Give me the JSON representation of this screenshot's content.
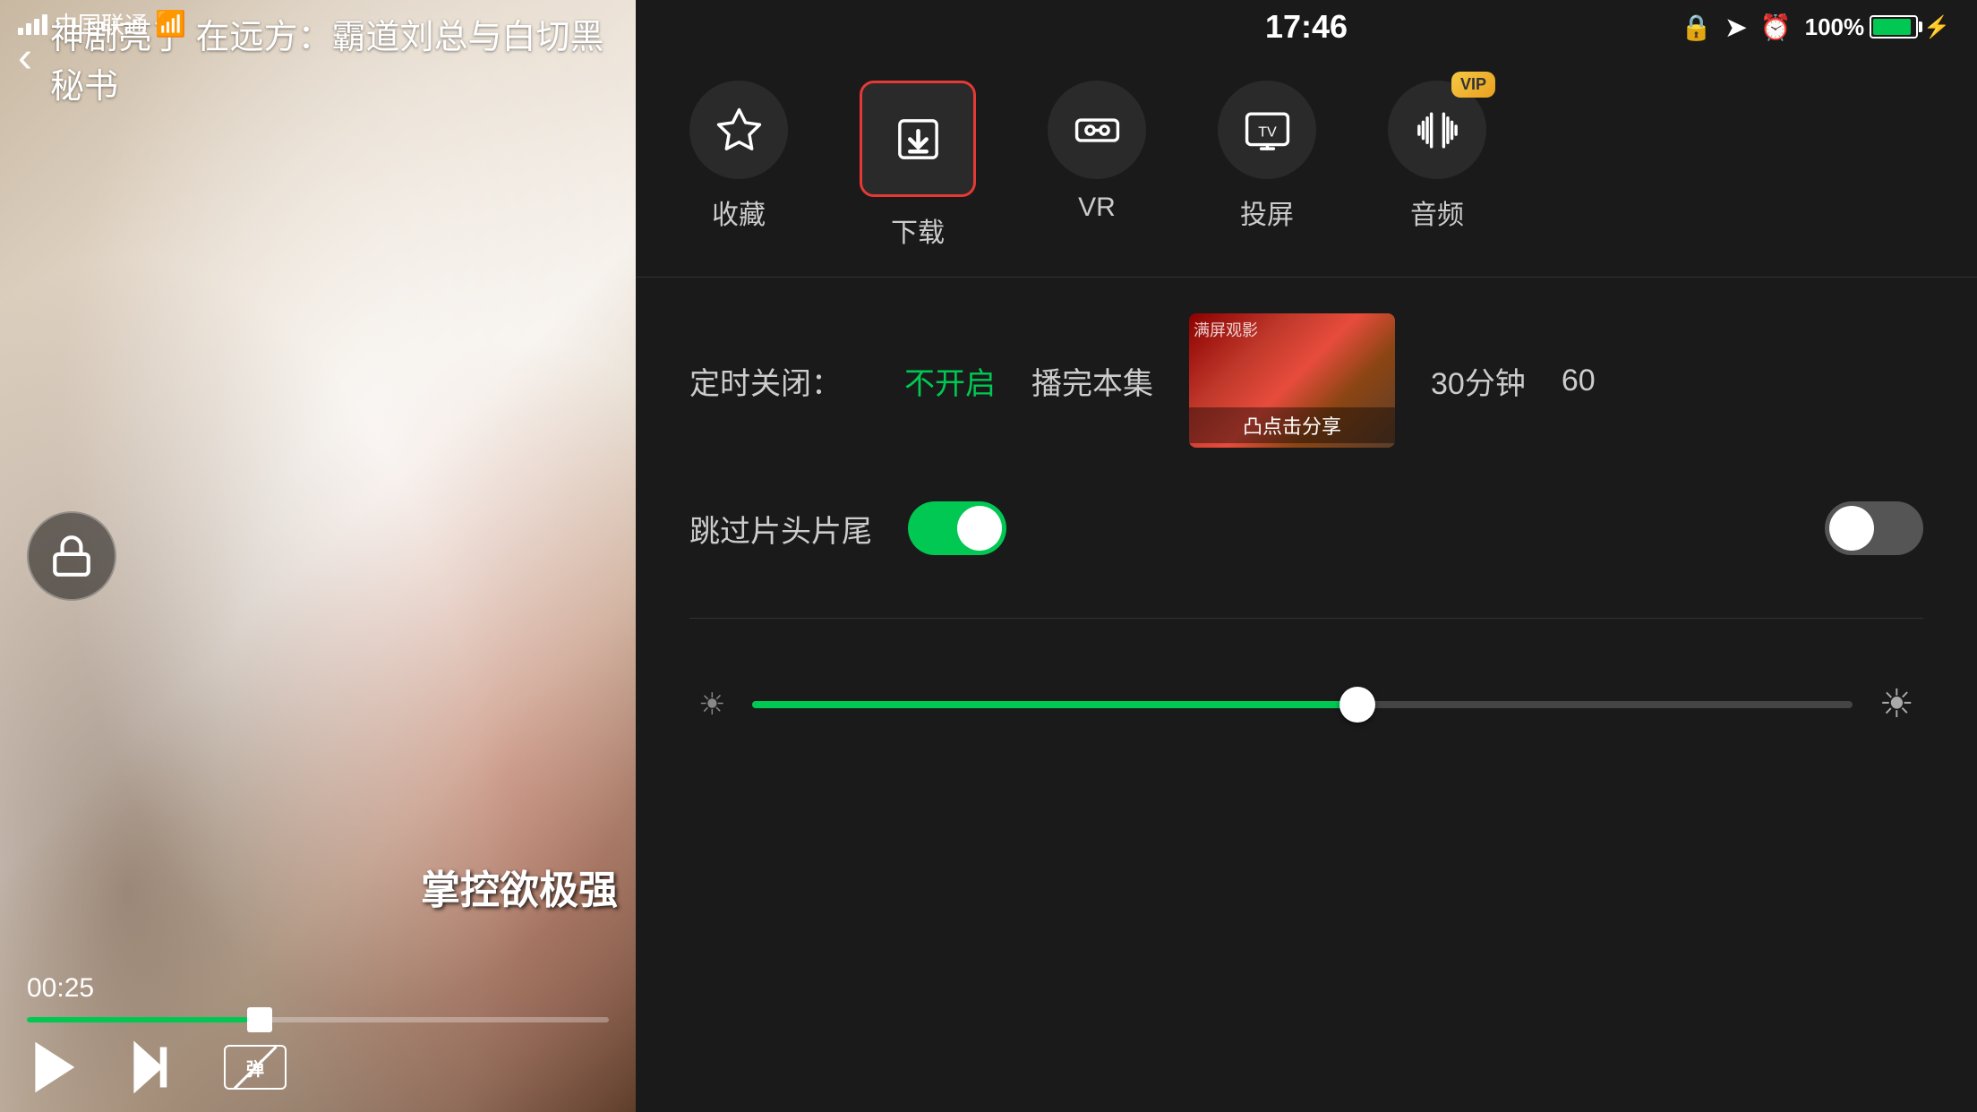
{
  "status_bar_left": {
    "carrier": "中国联通",
    "time": "17:46",
    "battery_percent": "100%"
  },
  "video": {
    "title": "神剧亮了 在远方：霸道刘总与白切黑秘书",
    "current_time": "00:25",
    "subtitle": "掌控欲极强",
    "progress_percent": 40
  },
  "icon_row": {
    "items": [
      {
        "key": "favorite",
        "label": "收藏",
        "selected": false,
        "vip": false
      },
      {
        "key": "download",
        "label": "下载",
        "selected": true,
        "vip": false
      },
      {
        "key": "vr",
        "label": "VR",
        "selected": false,
        "vip": false
      },
      {
        "key": "cast",
        "label": "投屏",
        "selected": false,
        "vip": false
      },
      {
        "key": "audio",
        "label": "音频",
        "selected": false,
        "vip": true
      }
    ]
  },
  "settings": {
    "timer_label": "定时关闭：",
    "timer_option_active": "不开启",
    "timer_option_2": "播完本集",
    "timer_option_3": "30分钟",
    "timer_option_4": "60",
    "skip_label": "跳过片头片尾",
    "skip_enabled": true,
    "second_toggle_enabled": false
  },
  "brightness": {
    "value": 55
  },
  "preview": {
    "overlay_text": "凸点击分享",
    "watermark": "满屏观影"
  }
}
